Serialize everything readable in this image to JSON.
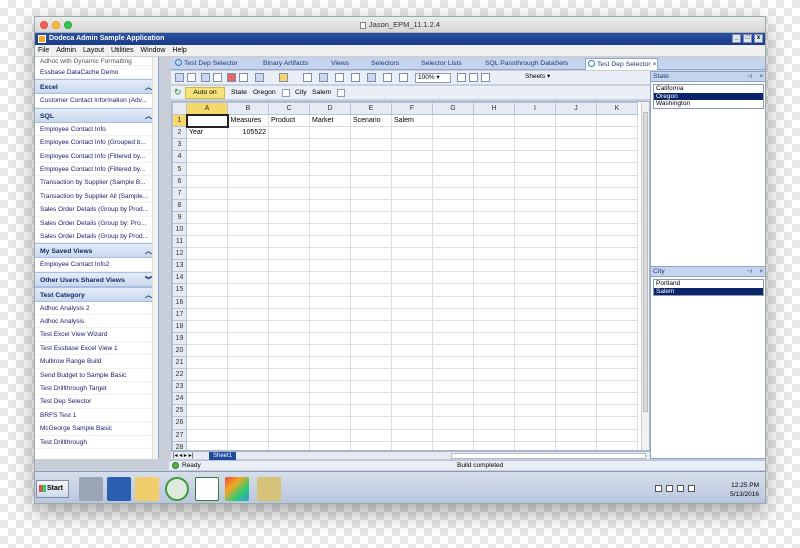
{
  "mac_window": {
    "title": "Jason_EPM_11.1.2.4"
  },
  "app": {
    "title": "Dodeca Admin Sample Application",
    "menu": [
      "File",
      "Admin",
      "Layout",
      "Utilities",
      "Window",
      "Help"
    ]
  },
  "sidebar": {
    "top_items": [
      "Adhoc with Dynamic Formatting",
      "Essbase DataCache Demo"
    ],
    "sections": [
      {
        "title": "Excel",
        "items": [
          "Customer Contact Information (Adv..."
        ]
      },
      {
        "title": "SQL",
        "items": [
          "Employee Contact Info",
          "Employee Contact Info (Grouped b...",
          "Employee Contact Info (Filtered by...",
          "Employee Contact Info (Filtered by...",
          "Transaction by Supplier (Sample B...",
          "Transaction by Supplier All (Sample...",
          "Sales Order Details (Group by Prod...",
          "Sales Order Details (Group by: Pro...",
          "Sales Order Details (Group by Prod..."
        ]
      },
      {
        "title": "My Saved Views",
        "items": [
          "Employee Contact Info2"
        ]
      },
      {
        "title": "Other Users Shared Views",
        "items": []
      },
      {
        "title": "Test Category",
        "items": [
          "Adhoc Analysis 2",
          "Adhoc Analysis",
          "Test Excel View Wizard",
          "Test Essbase Excel View 1",
          "Multirow Range Build",
          "Send Budget to Sample Basic",
          "Test Drillthrough Target",
          "Test Dep Selector",
          "BRFS Test 1",
          "McGeorge Sample Basic",
          "Test Drillthrough"
        ]
      }
    ]
  },
  "tabs": [
    "Test Dep Selector",
    "Binary Artifacts",
    "Views",
    "Selectors",
    "Selector Lists",
    "SQL Passthrough DataSets",
    "Test Dep Selector"
  ],
  "toolbar": {
    "zoom": "100%",
    "sheets_label": "Sheets",
    "auto_on": "Auto on",
    "state_label": "State",
    "state_value": "Oregon",
    "city_label": "City",
    "city_value": "Salem"
  },
  "grid": {
    "columns": [
      "A",
      "B",
      "C",
      "D",
      "E",
      "F",
      "G",
      "H",
      "I",
      "J",
      "K"
    ],
    "row_count": 28,
    "cells": {
      "1": {
        "B": "Measures",
        "C": "Product",
        "D": "Market",
        "E": "Scenario",
        "F": "Salem"
      },
      "2": {
        "A": "Year",
        "B": "105522"
      }
    },
    "sheet_tab": "Sheet1"
  },
  "state_panel": {
    "title": "State",
    "items": [
      "California",
      "Oregon",
      "Washington"
    ],
    "selected": "Oregon"
  },
  "city_panel": {
    "title": "City",
    "items": [
      "Portland",
      "Salem"
    ],
    "selected": "Salem"
  },
  "status": {
    "ready": "Ready",
    "message": "Build completed"
  },
  "taskbar": {
    "start": "Start",
    "time": "12:25 PM",
    "date": "5/13/2016"
  },
  "colors": {
    "accent": "#1f4aa0",
    "selection": "#0a246a",
    "header_highlight": "#f5d86a"
  }
}
